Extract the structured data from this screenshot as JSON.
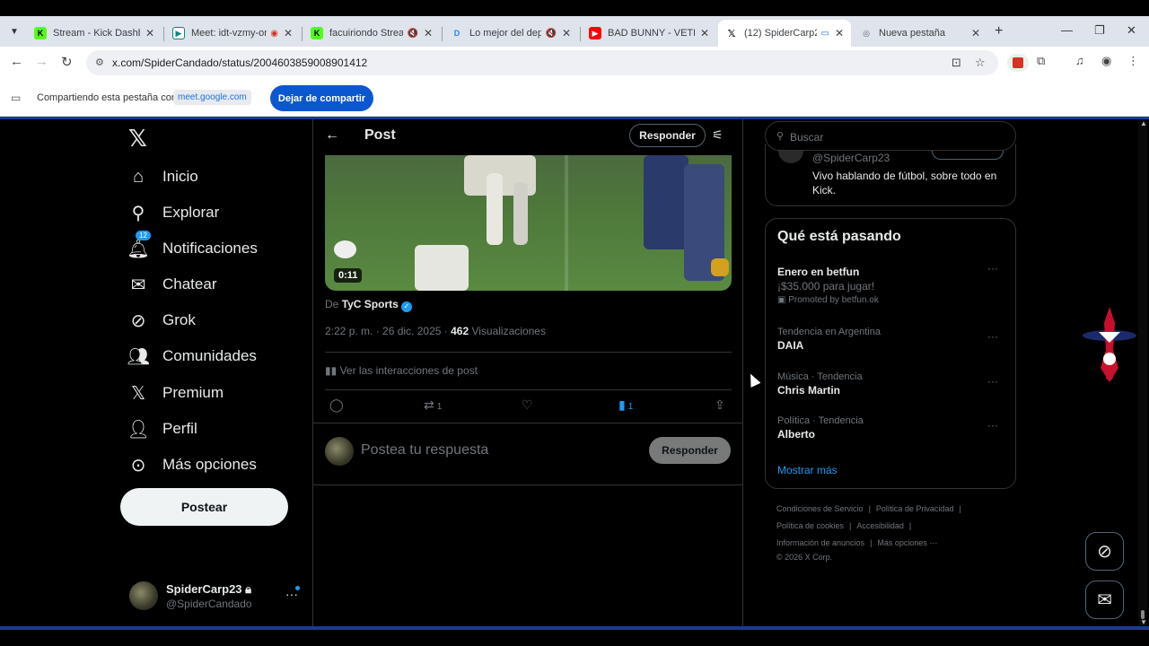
{
  "browser": {
    "tabs": [
      {
        "title": "Stream - Kick Dashboa",
        "favicon": "kick-icon",
        "color": "#53fc18"
      },
      {
        "title": "Meet: idt-vzmy-om",
        "favicon": "meet-icon",
        "color": "#00897b"
      },
      {
        "title": "facuiriondo Stream",
        "favicon": "kick-icon",
        "color": "#53fc18"
      },
      {
        "title": "Lo mejor del depor",
        "favicon": "d-icon",
        "color": "#1e88e5"
      },
      {
        "title": "BAD BUNNY - VETE | V",
        "favicon": "youtube-icon",
        "color": "#ff0000"
      },
      {
        "title": "(12) SpiderCarp23",
        "favicon": "x-icon",
        "color": "#000000"
      },
      {
        "title": "Nueva pestaña",
        "favicon": "chrome-icon",
        "color": "#5f6368"
      }
    ],
    "url": "x.com/SpiderCandado/status/2004603859008901412"
  },
  "sharing": {
    "text": "Compartiendo esta pestaña con",
    "host": "meet.google.com",
    "button": "Dejar de compartir"
  },
  "nav": {
    "items": [
      {
        "label": "Inicio",
        "icon": "home-icon"
      },
      {
        "label": "Explorar",
        "icon": "search-icon"
      },
      {
        "label": "Notificaciones",
        "icon": "bell-icon",
        "badge": "12"
      },
      {
        "label": "Chatear",
        "icon": "mail-icon"
      },
      {
        "label": "Grok",
        "icon": "grok-icon"
      },
      {
        "label": "Comunidades",
        "icon": "communities-icon"
      },
      {
        "label": "Premium",
        "icon": "x-icon"
      },
      {
        "label": "Perfil",
        "icon": "person-icon"
      },
      {
        "label": "Más opciones",
        "icon": "more-icon"
      }
    ],
    "post_button": "Postear",
    "profile": {
      "name": "SpiderCarp23",
      "handle": "@SpiderCandado"
    }
  },
  "post": {
    "header_title": "Post",
    "reply_button": "Responder",
    "video_time": "0:11",
    "source_prefix": "De",
    "source_name": "TyC Sports",
    "time": "2:22 p. m. · 26 dic. 2025 ·",
    "views_count": "462",
    "views_label": "Visualizaciones",
    "interactions": "Ver las interacciones de post",
    "counts": {
      "retweets": "1",
      "bookmarks": "1"
    },
    "compose_placeholder": "Postea tu respuesta",
    "compose_button": "Responder"
  },
  "sidebar": {
    "search_placeholder": "Buscar",
    "bio_handle": "@SpiderCarp23",
    "bio_text": "Vivo hablando de fútbol, sobre todo en Kick.",
    "trends_title": "Qué está pasando",
    "trends": [
      {
        "context": "",
        "name": "Enero en betfun",
        "sub": "¡$35.000 para jugar!",
        "promo": "Promoted by betfun.ok"
      },
      {
        "context": "Tendencia en Argentina",
        "name": "DAIA",
        "sub": "",
        "promo": ""
      },
      {
        "context": "Música · Tendencia",
        "name": "Chris Martin",
        "sub": "",
        "promo": ""
      },
      {
        "context": "Política · Tendencia",
        "name": "Alberto",
        "sub": "",
        "promo": ""
      }
    ],
    "show_more": "Mostrar más",
    "footer": [
      [
        "Condiciones de Servicio",
        "Política de Privacidad"
      ],
      [
        "Política de cookies",
        "Accesibilidad"
      ],
      [
        "Información de anuncios",
        "Más opciones ···"
      ],
      [
        "© 2026 X Corp."
      ]
    ]
  },
  "colors": {
    "accent": "#1d9bf0",
    "share_button": "#0b57d0",
    "frame_border": "#1b3a8f"
  }
}
